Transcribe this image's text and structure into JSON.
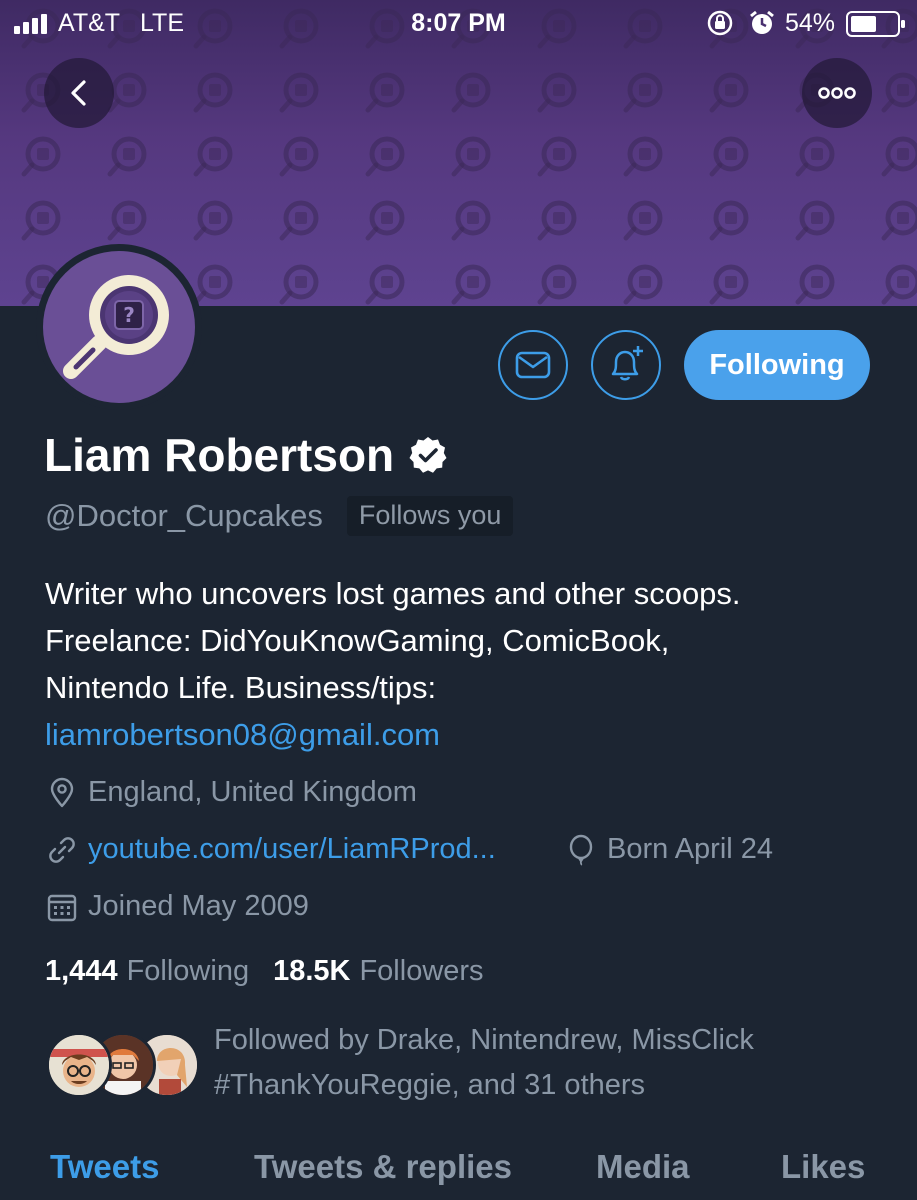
{
  "status_bar": {
    "carrier": "AT&T",
    "network": "LTE",
    "time": "8:07 PM",
    "battery_percent": "54%",
    "icons": [
      "signal-bars-icon",
      "orientation-lock-icon",
      "alarm-icon",
      "battery-icon"
    ]
  },
  "header": {
    "back_icon": "chevron-left-icon",
    "more_icon": "more-dots-icon"
  },
  "profile": {
    "name": "Liam Robertson",
    "verified": true,
    "handle": "@Doctor_Cupcakes",
    "follows_you_badge": "Follows you",
    "bio_lines": [
      "Writer who uncovers lost games and other scoops.",
      "Freelance: DidYouKnowGaming, ComicBook,",
      "Nintendo Life. Business/tips:"
    ],
    "bio_email": "liamrobertson08@gmail.com",
    "location": "England, United Kingdom",
    "website": "youtube.com/user/LiamRProd...",
    "birthday": "Born April 24",
    "joined": "Joined May 2009",
    "following_count": "1,444",
    "following_label": "Following",
    "followers_count": "18.5K",
    "followers_label": "Followers"
  },
  "actions": {
    "message_icon": "envelope-icon",
    "notify_icon": "bell-plus-icon",
    "following_button": "Following"
  },
  "followed_by": {
    "line1": "Followed by Drake, Nintendrew, MissClick",
    "line2": "#ThankYouReggie, and 31 others"
  },
  "tabs": [
    {
      "label": "Tweets",
      "active": true
    },
    {
      "label": "Tweets & replies",
      "active": false
    },
    {
      "label": "Media",
      "active": false
    },
    {
      "label": "Likes",
      "active": false
    }
  ],
  "colors": {
    "background": "#1c2532",
    "accent": "#3d9de8",
    "secondary_text": "#8a97a6",
    "banner": "#55387f"
  }
}
